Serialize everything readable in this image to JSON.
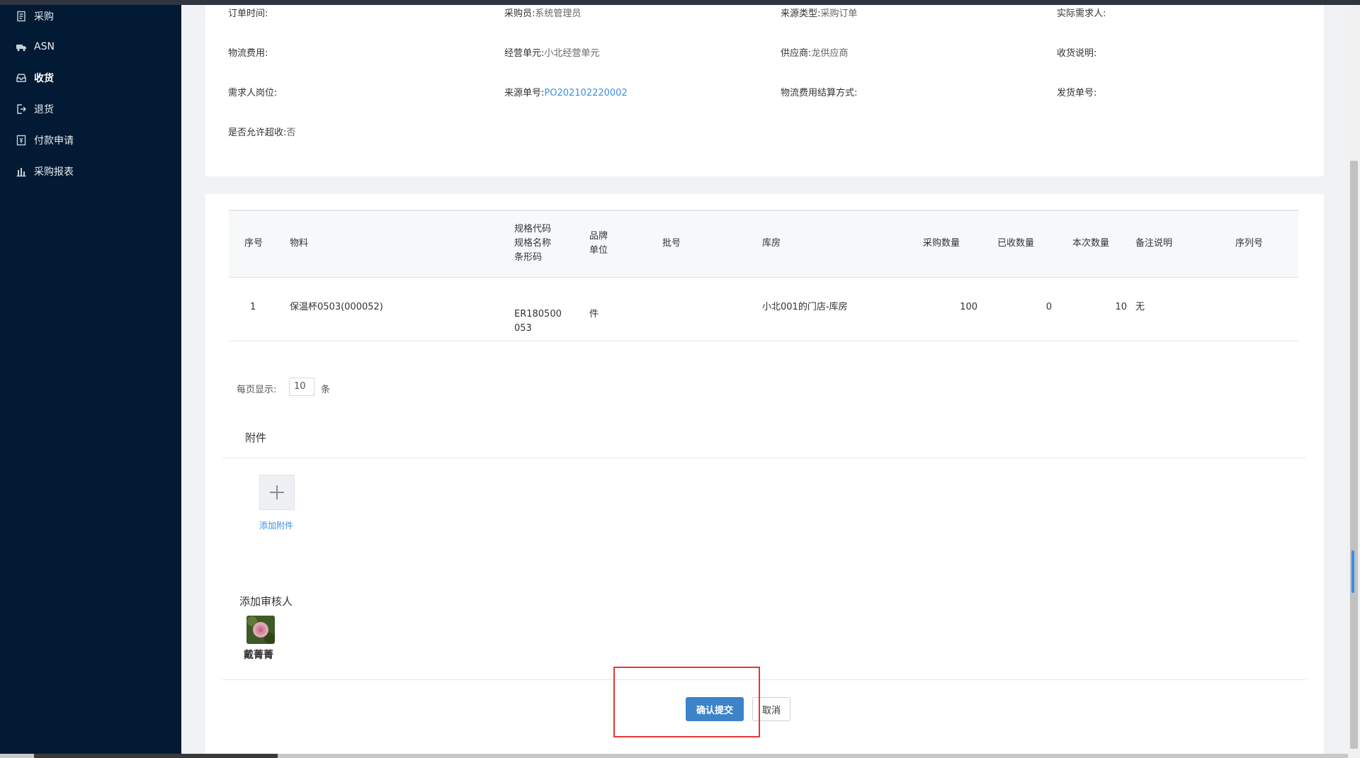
{
  "sidebar": {
    "items": [
      {
        "label": "采购",
        "icon": "list-icon"
      },
      {
        "label": "ASN",
        "icon": "truck-icon"
      },
      {
        "label": "收货",
        "icon": "inbox-icon"
      },
      {
        "label": "退货",
        "icon": "exit-icon"
      },
      {
        "label": "付款申请",
        "icon": "payment-icon"
      },
      {
        "label": "采购报表",
        "icon": "bar-chart-icon"
      }
    ]
  },
  "info": {
    "order_time": {
      "label": "订单时间:",
      "value": ""
    },
    "buyer": {
      "label": "采购员:",
      "value": "系统管理员"
    },
    "source_type": {
      "label": "来源类型:",
      "value": "采购订单"
    },
    "actual_requester": {
      "label": "实际需求人:",
      "value": ""
    },
    "logistics_fee": {
      "label": "物流费用:",
      "value": ""
    },
    "business_unit": {
      "label": "经营单元:",
      "value": "小北经营单元"
    },
    "supplier": {
      "label": "供应商:",
      "value": "龙供应商"
    },
    "receipt_note": {
      "label": "收货说明:",
      "value": ""
    },
    "requester_post": {
      "label": "需求人岗位:",
      "value": ""
    },
    "source_no": {
      "label": "来源单号:",
      "value": "PO202102220002"
    },
    "logistics_settlement": {
      "label": "物流费用结算方式:",
      "value": ""
    },
    "shipment_no": {
      "label": "发货单号:",
      "value": ""
    },
    "allow_over_receive": {
      "label": "是否允许超收:",
      "value": "否"
    }
  },
  "table": {
    "headers": {
      "seq": "序号",
      "material": "物料",
      "spec_code": "规格代码",
      "spec_name": "规格名称",
      "barcode": "条形码",
      "brand": "品牌",
      "unit": "单位",
      "batch": "批号",
      "warehouse": "库房",
      "purchase_qty": "采购数量",
      "received_qty": "已收数量",
      "current_qty": "本次数量",
      "remark": "备注说明",
      "serial_no": "序列号"
    },
    "rows": [
      {
        "seq": "1",
        "material": "保温杯0503(000052)",
        "spec_line1": "ER180500",
        "spec_line2": "053",
        "unit": "件",
        "warehouse": "小北001的门店-库房",
        "purchase_qty": "100",
        "received_qty": "0",
        "current_qty": "10",
        "remark": "无"
      }
    ]
  },
  "pager": {
    "label": "每页显示:",
    "value": "10",
    "unit": "条"
  },
  "attachment": {
    "title": "附件",
    "add_label": "添加附件"
  },
  "reviewer": {
    "title": "添加审核人",
    "name": "戴菁菁"
  },
  "actions": {
    "confirm": "确认提交",
    "cancel": "取消"
  },
  "colors": {
    "sidebar": "#021a33",
    "accent": "#3c83c8",
    "link": "#3b8ee6",
    "highlight": "#e53935"
  }
}
